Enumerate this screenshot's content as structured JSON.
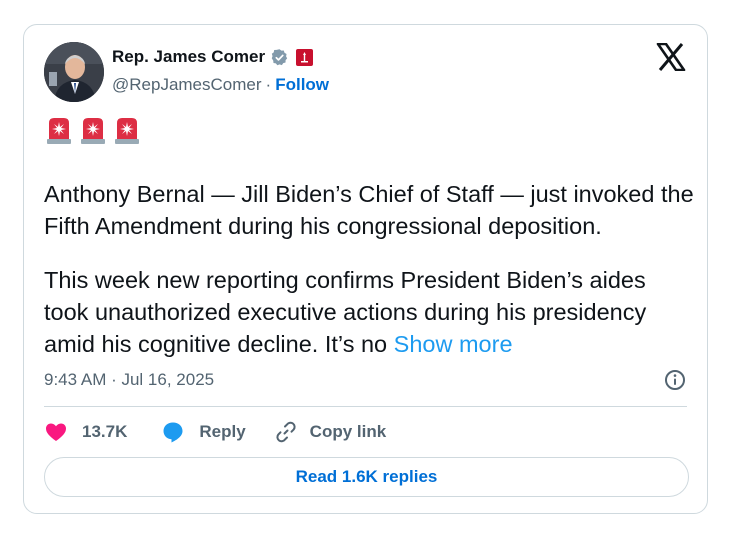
{
  "author": {
    "name": "Rep. James Comer",
    "handle": "@RepJamesComer",
    "separator": "·",
    "follow_label": "Follow"
  },
  "tweet": {
    "emoji_icons": [
      "police-car-light-icon",
      "police-car-light-icon",
      "police-car-light-icon"
    ],
    "paragraph_1": "Anthony Bernal — Jill Biden’s Chief of Staff — just invoked the Fifth Amendment during his congressional deposition.",
    "paragraph_2": "This week new reporting confirms President Biden’s aides took unauthorized executive actions during his presidency amid his cognitive decline. It’s no ",
    "show_more_label": "Show more",
    "timestamp": "9:43 AM · Jul 16, 2025"
  },
  "actions": {
    "like_count": "13.7K",
    "reply_label": "Reply",
    "copy_link_label": "Copy link"
  },
  "read_replies_label": "Read 1.6K replies",
  "colors": {
    "link_blue": "#006fd6",
    "show_more_blue": "#1d9bf0",
    "like_pink": "#f91880",
    "reply_blue": "#1d9bf0",
    "muted_gray": "#536471",
    "border": "#cfd9de"
  }
}
